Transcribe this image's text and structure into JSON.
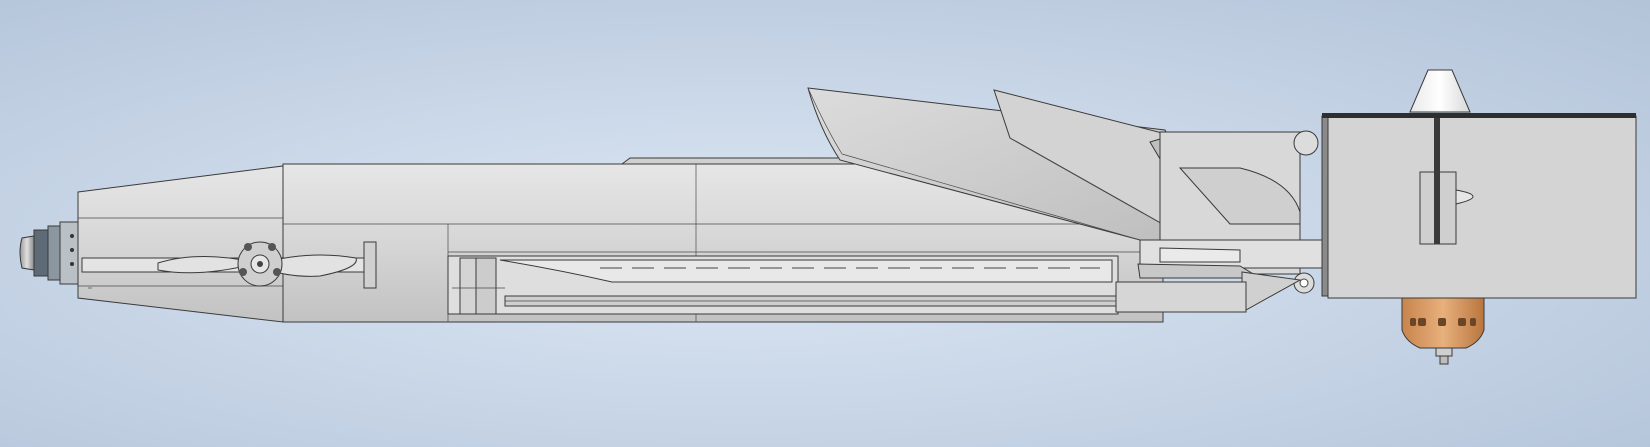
{
  "viewport": {
    "background_top": "#c9d7e8",
    "background_center": "#dde7f3",
    "background_edge": "#b3c3d8"
  },
  "model": {
    "body_color": "#d9d9d9",
    "body_shade": "#c4c4c4",
    "wing_color": "#cfcfcf",
    "nozzle_color": "#d9a070",
    "cone_color": "#f2f2f2",
    "dark_accent": "#3a3a3a"
  }
}
